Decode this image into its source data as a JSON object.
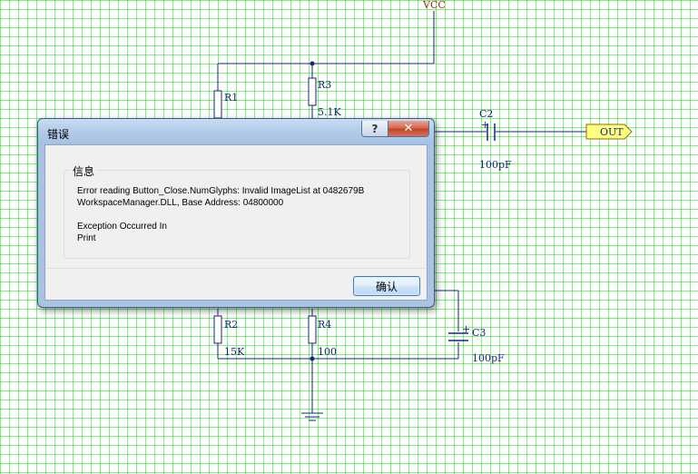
{
  "schematic": {
    "grid_color": "#00dd00",
    "wire_color": "#1a237e",
    "labels": {
      "vcc": "VCC",
      "r1": "R1",
      "r2": "R2",
      "r2_value": "15K",
      "r3": "R3",
      "r3_value": "5.1K",
      "r4": "R4",
      "r4_value": "100",
      "c2": "C2",
      "c2_value": "100pF",
      "c2_plus": "+",
      "c3": "C3",
      "c3_value": "100pF",
      "c3_plus": "+",
      "out_port": "OUT"
    }
  },
  "dialog": {
    "title": "错误",
    "help_glyph": "?",
    "close_glyph": "✕",
    "group_title": "信息",
    "message_line1": "Error reading Button_Close.NumGlyphs: Invalid ImageList at 0482679B",
    "message_line2": "WorkspaceManager.DLL, Base Address: 04800000",
    "message_line3": "Exception Occurred In",
    "message_line4": "Print",
    "ok_label": "确认"
  }
}
